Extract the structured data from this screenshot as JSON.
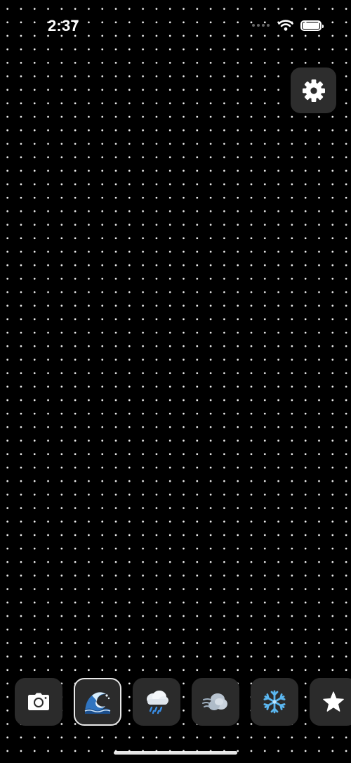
{
  "status_bar": {
    "time": "2:37",
    "battery_level": 1.0
  },
  "settings": {
    "icon": "gear-icon"
  },
  "toolbar": {
    "selected_index": 1,
    "items": [
      {
        "name": "camera",
        "icon": "camera-icon"
      },
      {
        "name": "wave",
        "icon": "wave-icon"
      },
      {
        "name": "rain",
        "icon": "rain-cloud-icon"
      },
      {
        "name": "wind",
        "icon": "wind-icon"
      },
      {
        "name": "snow",
        "icon": "snowflake-icon"
      },
      {
        "name": "star",
        "icon": "star-icon"
      }
    ]
  },
  "colors": {
    "background": "#000000",
    "dots": "#ffffff",
    "button_background": "#2b2b2b",
    "selected_border": "#e8e8e8"
  }
}
